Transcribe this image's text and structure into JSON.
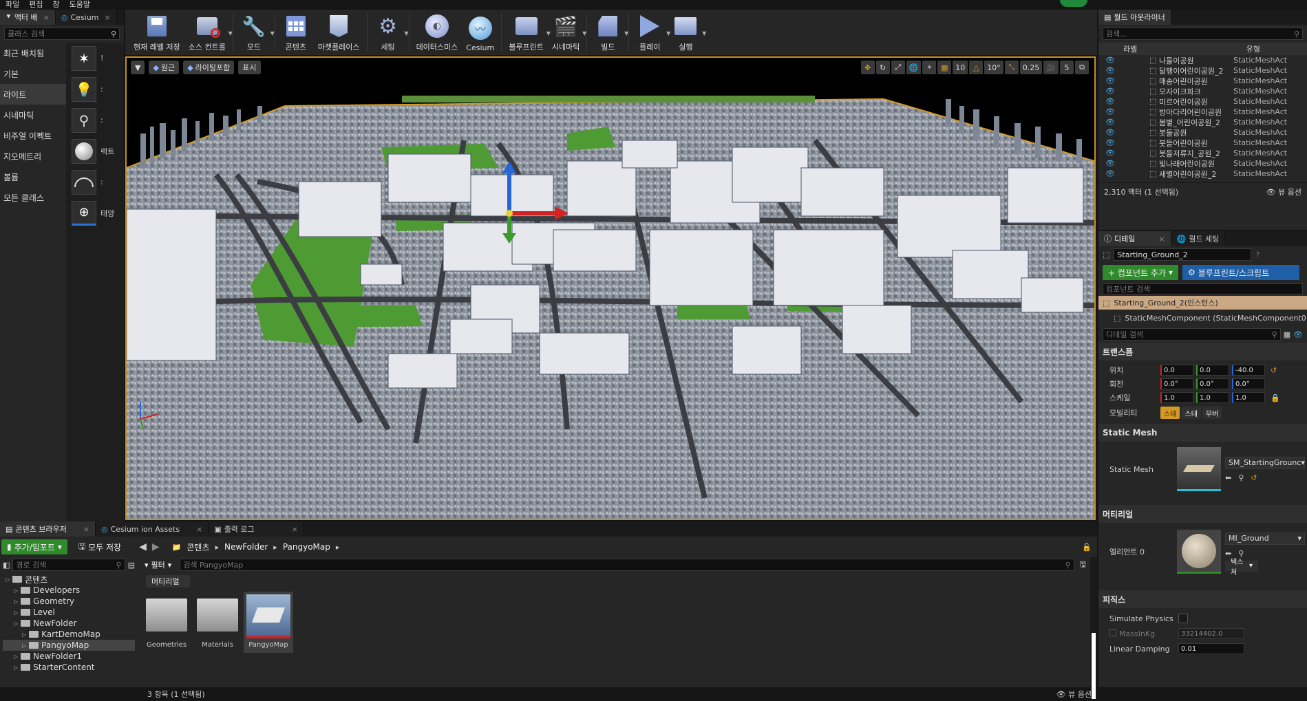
{
  "menu": [
    "파일",
    "편집",
    "창",
    "도움말"
  ],
  "left": {
    "tabs": [
      "액터 배",
      "Cesium"
    ],
    "search_placeholder": "클래스 검색",
    "categories": [
      "최근 배치됨",
      "기본",
      "라이트",
      "시네마틱",
      "비주얼 이펙트",
      "지오메트리",
      "볼륨",
      "모든 클래스"
    ],
    "items": [
      "!",
      "",
      ":",
      "렉트",
      ":",
      "태양"
    ]
  },
  "toolbar": [
    {
      "label": "현재 레벨 저장",
      "icon": "save-icon"
    },
    {
      "label": "소스 컨트롤",
      "icon": "source-control-icon"
    },
    {
      "label": "모드",
      "icon": "modes-icon"
    },
    {
      "label": "콘텐츠",
      "icon": "content-icon"
    },
    {
      "label": "마켓플레이스",
      "icon": "marketplace-icon"
    },
    {
      "label": "세팅",
      "icon": "settings-icon"
    },
    {
      "label": "데이터스미스",
      "icon": "datasmith-icon"
    },
    {
      "label": "Cesium",
      "icon": "cesium-icon"
    },
    {
      "label": "블루프린트",
      "icon": "blueprint-icon"
    },
    {
      "label": "시네마틱",
      "icon": "cinematics-icon"
    },
    {
      "label": "빌드",
      "icon": "build-icon"
    },
    {
      "label": "플레이",
      "icon": "play-icon"
    },
    {
      "label": "실행",
      "icon": "launch-icon"
    }
  ],
  "viewport": {
    "view_mode": "원근",
    "lighting": "라이팅포함",
    "show": "표시",
    "grid_snap": "10",
    "rot_snap": "10°",
    "scale_snap": "0.25",
    "cam_speed": "5"
  },
  "outliner": {
    "tab": "월드 아웃라이너",
    "search_placeholder": "검색...",
    "col_label": "라벨",
    "col_type": "유형",
    "rows": [
      {
        "name": "나들이공원",
        "type": "StaticMeshAct"
      },
      {
        "name": "달팽이어린이공원_2",
        "type": "StaticMeshAct"
      },
      {
        "name": "매송어린이공원",
        "type": "StaticMeshAct"
      },
      {
        "name": "모자이크파크",
        "type": "StaticMeshAct"
      },
      {
        "name": "미르어린이공원",
        "type": "StaticMeshAct"
      },
      {
        "name": "방아다리어린이공원",
        "type": "StaticMeshAct"
      },
      {
        "name": "봄볕_어린이공원_2",
        "type": "StaticMeshAct"
      },
      {
        "name": "봇들공원",
        "type": "StaticMeshAct"
      },
      {
        "name": "봇들어린이공원",
        "type": "StaticMeshAct"
      },
      {
        "name": "봇들저류지_공원_2",
        "type": "StaticMeshAct"
      },
      {
        "name": "빛나래어린이공원",
        "type": "StaticMeshAct"
      },
      {
        "name": "새별어린이공원_2",
        "type": "StaticMeshAct"
      }
    ],
    "status": "2,310 액터 (1 선택됨)",
    "view_options": "뷰 옵션"
  },
  "details": {
    "tab1": "디테일",
    "tab2": "월드 세팅",
    "actor_name": "Starting_Ground_2",
    "add_component": "+ 컴포넌트 추가",
    "blueprint": "블루프린트/스크립트",
    "comp_search": "컴포넌트 검색",
    "instance": "Starting_Ground_2(인스턴스)",
    "component": "StaticMeshComponent (StaticMeshComponent0",
    "detail_search": "디테일 검색",
    "transform": "트랜스폼",
    "location_label": "위치",
    "rotation_label": "회전",
    "scale_label": "스케일",
    "mobility_label": "모빌리티",
    "location": [
      "0.0",
      "0.0",
      "-40.0"
    ],
    "rotation": [
      "0.0°",
      "0.0°",
      "0.0°"
    ],
    "scale": [
      "1.0",
      "1.0",
      "1.0"
    ],
    "mobility": [
      "스태",
      "스태",
      "무버"
    ],
    "static_mesh_section": "Static Mesh",
    "static_mesh_label": "Static Mesh",
    "static_mesh_value": "SM_StartingGrounc",
    "material_section": "머티리얼",
    "element_label": "엘리먼트 0",
    "material_value": "MI_Ground",
    "texture_btn": "텍스처",
    "physics_section": "피직스",
    "simulate_physics": "Simulate Physics",
    "mass_label": "MassInKg",
    "mass_value": "33214402.0",
    "linear_damping_label": "Linear Damping",
    "linear_damping_value": "0.01"
  },
  "bottom": {
    "tabs": [
      "콘텐츠 브라우저",
      "Cesium ion Assets",
      "출력 로그"
    ],
    "add_import": "추가/임포트",
    "save_all": "모두 저장",
    "path": [
      "콘텐츠",
      "NewFolder",
      "PangyoMap"
    ],
    "path_search_placeholder": "경로 검색",
    "filter": "필터",
    "asset_search_placeholder": "검색 PangyoMap",
    "filter_chip": "머티리얼",
    "tree": [
      {
        "label": "콘텐츠",
        "indent": 0
      },
      {
        "label": "Developers",
        "indent": 1
      },
      {
        "label": "Geometry",
        "indent": 1
      },
      {
        "label": "Level",
        "indent": 1
      },
      {
        "label": "NewFolder",
        "indent": 1
      },
      {
        "label": "KartDemoMap",
        "indent": 2
      },
      {
        "label": "PangyoMap",
        "indent": 2
      },
      {
        "label": "NewFolder1",
        "indent": 1
      },
      {
        "label": "StarterContent",
        "indent": 1
      }
    ],
    "assets": [
      "Geometries",
      "Materials",
      "PangyoMap"
    ],
    "status": "3 항목 (1 선택됨)",
    "view_options": "뷰 옵션"
  },
  "colors": {
    "accent_orange": "#c7901f",
    "green_btn": "#2f8a2b",
    "blue_btn": "#1f5fa8",
    "gizmo_x": "#d32222",
    "gizmo_y": "#3a9b2a",
    "gizmo_z": "#2566d8"
  }
}
